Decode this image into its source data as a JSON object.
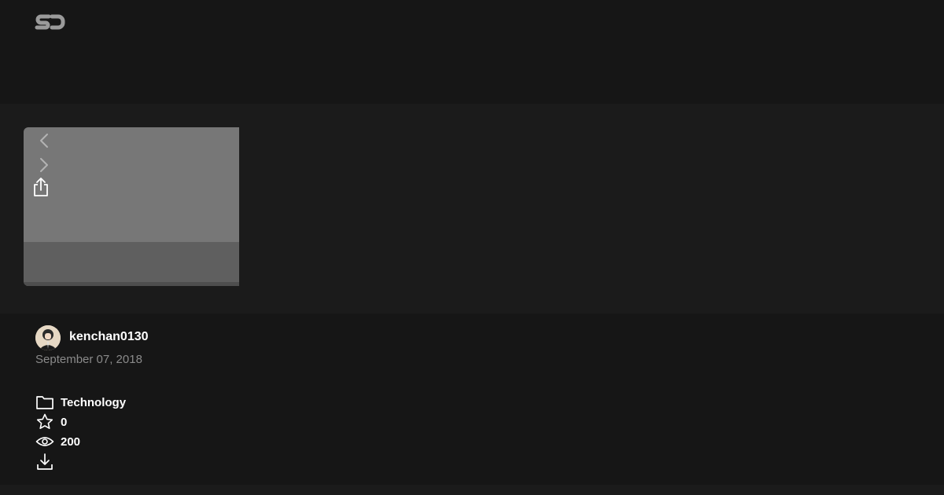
{
  "header": {
    "logo_text": "SD",
    "logo_icon": "speakerdeck-logo-icon"
  },
  "viewer": {
    "controls": {
      "prev_icon": "chevron-left-icon",
      "next_icon": "chevron-right-icon",
      "share_icon": "share-icon"
    }
  },
  "author": {
    "name": "kenchan0130",
    "avatar_icon": "avatar"
  },
  "date": "September 07, 2018",
  "stats": {
    "category": "Technology",
    "category_icon": "folder-icon",
    "stars": "0",
    "stars_icon": "star-icon",
    "views": "200",
    "views_icon": "eye-icon",
    "download_icon": "download-icon"
  },
  "colors": {
    "background": "#161616",
    "viewer_background": "#1b1b1b",
    "slide_gray": "#777777",
    "text_primary": "#ffffff",
    "text_muted": "#8a8a8a"
  }
}
